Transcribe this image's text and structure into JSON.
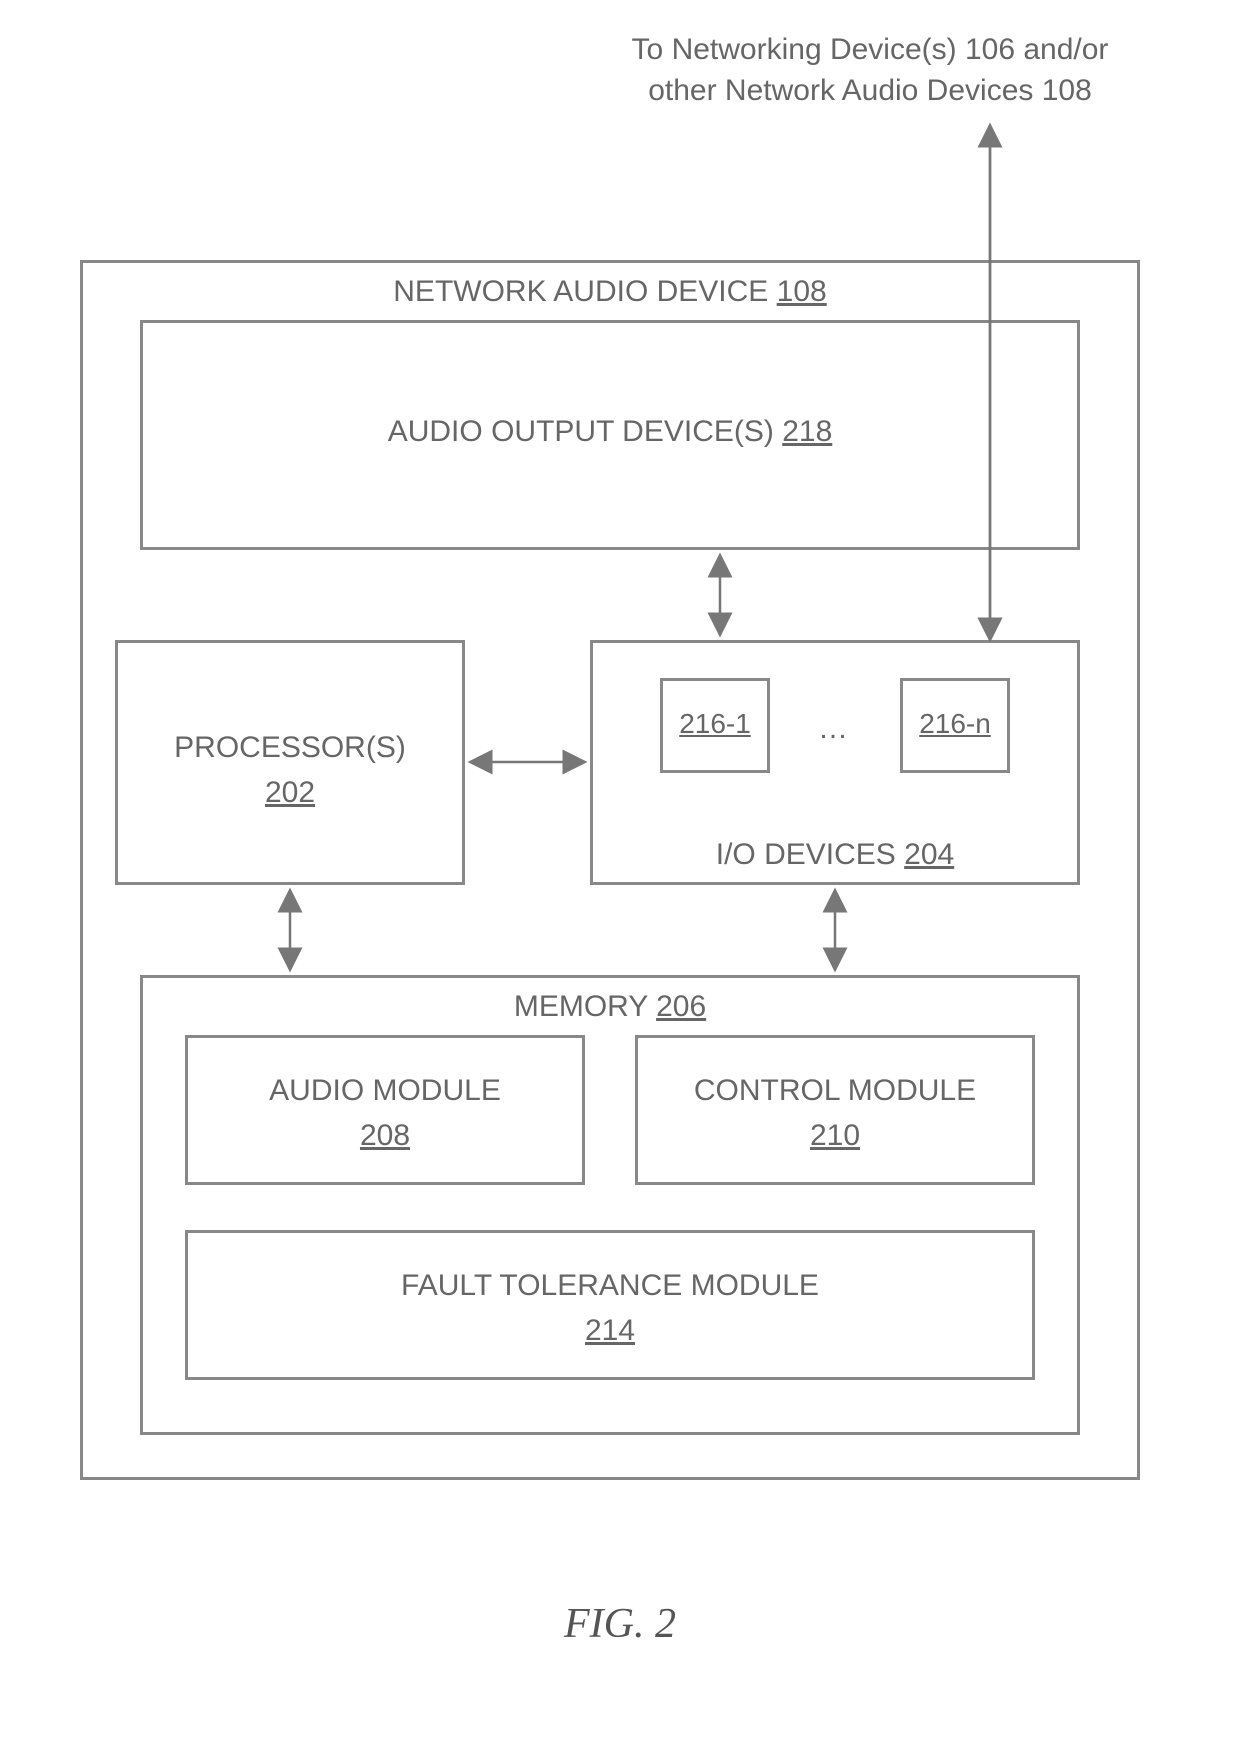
{
  "caption_top_line1": "To Networking Device(s) 106 and/or",
  "caption_top_line2": "other Network Audio Devices 108",
  "outer": {
    "title": "NETWORK AUDIO DEVICE",
    "ref": "108"
  },
  "audio_out": {
    "title": "AUDIO OUTPUT DEVICE(S)",
    "ref": "218"
  },
  "processor": {
    "title": "PROCESSOR(S)",
    "ref": "202"
  },
  "io": {
    "title": "I/O DEVICES",
    "ref": "204",
    "port1": "216-1",
    "ellipsis": "…",
    "portn": "216-n"
  },
  "memory": {
    "title": "MEMORY",
    "ref": "206"
  },
  "audio_mod": {
    "title": "AUDIO MODULE",
    "ref": "208"
  },
  "control_mod": {
    "title": "CONTROL MODULE",
    "ref": "210"
  },
  "fault_mod": {
    "title": "FAULT TOLERANCE MODULE",
    "ref": "214"
  },
  "figure": "FIG. 2"
}
